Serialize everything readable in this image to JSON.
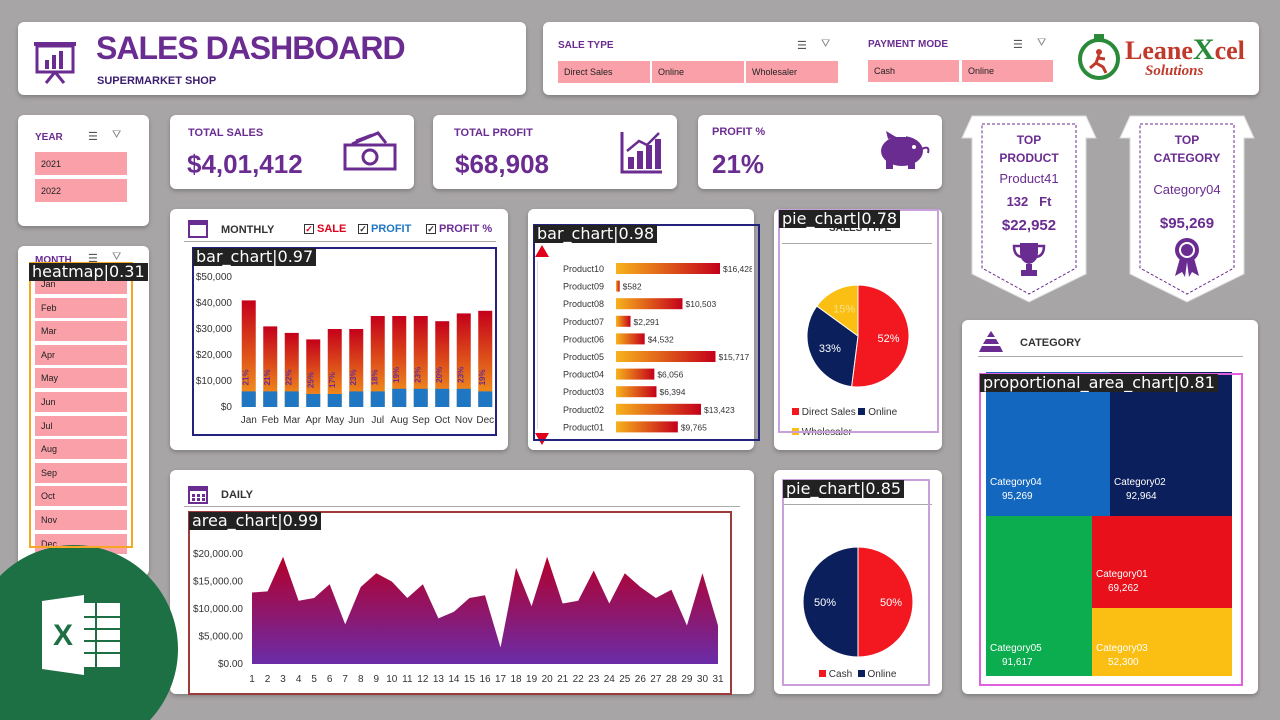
{
  "header": {
    "title": "SALES DASHBOARD",
    "subtitle": "SUPERMARKET SHOP"
  },
  "sale_type": {
    "label": "SALE TYPE",
    "options": [
      "Direct Sales",
      "Online",
      "Wholesaler"
    ]
  },
  "payment_mode": {
    "label": "PAYMENT MODE",
    "options": [
      "Cash",
      "Online"
    ]
  },
  "brand": {
    "name_part1": "Leane",
    "name_part2": "X",
    "name_part3": "cel",
    "tagline": "Solutions"
  },
  "year": {
    "label": "YEAR",
    "options": [
      "2021",
      "2022"
    ]
  },
  "month": {
    "label": "MONTH",
    "options": [
      "Jan",
      "Feb",
      "Mar",
      "Apr",
      "May",
      "Jun",
      "Jul",
      "Aug",
      "Sep",
      "Oct",
      "Nov",
      "Dec"
    ]
  },
  "kpis": {
    "total_sales": {
      "label": "TOTAL SALES",
      "value": "$4,01,412"
    },
    "total_profit": {
      "label": "TOTAL PROFIT",
      "value": "$68,908"
    },
    "profit_pct": {
      "label": "PROFIT %",
      "value": "21%"
    }
  },
  "top_product": {
    "line1": "TOP",
    "line2": "PRODUCT",
    "name": "Product41",
    "qty": "132",
    "unit": "Ft",
    "value": "$22,952"
  },
  "top_category": {
    "line1": "TOP",
    "line2": "CATEGORY",
    "name": "Category04",
    "value": "$95,269"
  },
  "monthly": {
    "title": "MONTHLY",
    "legend": [
      "SALE",
      "PROFIT",
      "PROFIT %"
    ]
  },
  "daily": {
    "title": "DAILY"
  },
  "category": {
    "title": "CATEGORY"
  },
  "sales_type_title": "SALES TYPE",
  "annotations": {
    "heatmap": "heatmap|0.31",
    "bar_monthly": "bar_chart|0.97",
    "bar_products": "bar_chart|0.98",
    "pie_sales": "pie_chart|0.78",
    "area_daily": "area_chart|0.99",
    "pie_payment": "pie_chart|0.85",
    "treemap": "proportional_area_chart|0.81"
  },
  "colors": {
    "accent": "#6a2c91",
    "sale": "#e0001b",
    "profit": "#1f77c4",
    "slicer": "#f9a0a8"
  },
  "chart_data": [
    {
      "type": "bar",
      "name": "monthly",
      "categories": [
        "Jan",
        "Feb",
        "Mar",
        "Apr",
        "May",
        "Jun",
        "Jul",
        "Aug",
        "Sep",
        "Oct",
        "Nov",
        "Dec"
      ],
      "series": [
        {
          "name": "SALE",
          "values": [
            41000,
            31000,
            28500,
            26000,
            30000,
            30000,
            35000,
            35000,
            35000,
            33000,
            36000,
            37000
          ]
        },
        {
          "name": "PROFIT",
          "values": [
            6000,
            6000,
            6000,
            5000,
            5000,
            6000,
            6000,
            7000,
            7000,
            7000,
            7000,
            6000
          ]
        }
      ],
      "labels": [
        "21%",
        "21%",
        "22%",
        "25%",
        "17%",
        "23%",
        "18%",
        "19%",
        "23%",
        "20%",
        "23%",
        "19%"
      ],
      "ylim": [
        0,
        50000
      ],
      "yticks": [
        "$0",
        "$10,000",
        "$20,000",
        "$30,000",
        "$40,000",
        "$50,000"
      ]
    },
    {
      "type": "bar",
      "name": "products",
      "orientation": "horizontal",
      "categories": [
        "Product10",
        "Product09",
        "Product08",
        "Product07",
        "Product06",
        "Product05",
        "Product04",
        "Product03",
        "Product02",
        "Product01"
      ],
      "values": [
        16428,
        582,
        10503,
        2291,
        4532,
        15717,
        6056,
        6394,
        13423,
        9765
      ],
      "labels": [
        "$16,428",
        "$582",
        "$10,503",
        "$2,291",
        "$4,532",
        "$15,717",
        "$6,056",
        "$6,394",
        "$13,423",
        "$9,765"
      ]
    },
    {
      "type": "pie",
      "name": "sales_type",
      "categories": [
        "Direct Sales",
        "Online",
        "Wholesaler"
      ],
      "values": [
        52,
        33,
        15
      ],
      "labels": [
        "52%",
        "33%",
        "15%"
      ],
      "colors": [
        "#f3171f",
        "#0b1f5c",
        "#fbbf13"
      ]
    },
    {
      "type": "pie",
      "name": "payment_mode",
      "categories": [
        "Cash",
        "Online"
      ],
      "values": [
        50,
        50
      ],
      "labels": [
        "50%",
        "50%"
      ],
      "colors": [
        "#f3171f",
        "#0b1f5c"
      ]
    },
    {
      "type": "area",
      "name": "daily",
      "x": [
        1,
        2,
        3,
        4,
        5,
        6,
        7,
        8,
        9,
        10,
        11,
        12,
        13,
        14,
        15,
        16,
        17,
        18,
        19,
        20,
        21,
        22,
        23,
        24,
        25,
        26,
        27,
        28,
        29,
        30,
        31
      ],
      "values": [
        13000,
        13200,
        19500,
        11500,
        12000,
        14500,
        7200,
        14000,
        16500,
        15000,
        12000,
        14500,
        8300,
        9500,
        12000,
        12500,
        3000,
        17500,
        10500,
        19500,
        11000,
        11500,
        17000,
        11000,
        16500,
        14000,
        12000,
        13500,
        7000,
        16500,
        7000
      ],
      "ylim": [
        0,
        20000
      ],
      "yticks": [
        "$0.00",
        "$5,000.00",
        "$10,000.00",
        "$15,000.00",
        "$20,000.00"
      ]
    },
    {
      "type": "heatmap",
      "name": "category_treemap",
      "categories": [
        "Category04",
        "Category02",
        "Category01",
        "Category05",
        "Category03"
      ],
      "values": [
        "95,269",
        "92,964",
        "69,262",
        "91,617",
        "52,300"
      ],
      "colors": [
        "#1367bf",
        "#0b1f5c",
        "#e8101b",
        "#0cad4f",
        "#fbbf13"
      ]
    }
  ]
}
